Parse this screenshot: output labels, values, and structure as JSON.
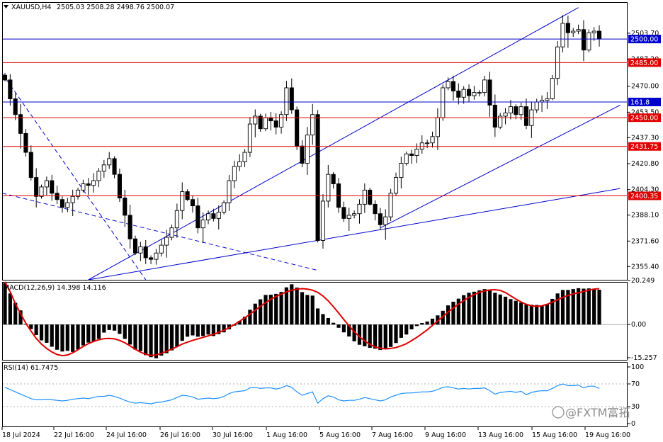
{
  "header": {
    "symbol": "XAUUSD,H4",
    "ohlc": "2505.03 2508.28 2498.76 2500.07"
  },
  "macd": {
    "label": "MACD(12,26,9) 14.398 14.116"
  },
  "rsi": {
    "label": "RSI(14) 61.7475"
  },
  "watermark": {
    "text": "@FXTM富拓"
  },
  "colors": {
    "bull": "#ffffff",
    "bear": "#000000",
    "trendline": "#0000cd",
    "support": "#e00000",
    "macd_signal": "#e00000",
    "rsi_line": "#1e90ff"
  },
  "chart_data": [
    {
      "type": "candlestick",
      "name": "price",
      "ylim": [
        2347,
        2523
      ],
      "y_ticks": [
        "2503.70",
        "2487.20",
        "2470.00",
        "2453.50",
        "2437.30",
        "2420.80",
        "2404.30",
        "2388.10",
        "2371.60",
        "2355.40"
      ],
      "x_ticks": [
        "18 Jul 2024",
        "22 Jul 16:00",
        "24 Jul 16:00",
        "26 Jul 16:00",
        "30 Jul 16:00",
        "1 Aug 16:00",
        "5 Aug 16:00",
        "7 Aug 16:00",
        "9 Aug 16:00",
        "13 Aug 16:00",
        "15 Aug 16:00",
        "19 Aug 16:00"
      ],
      "horizontal_levels": [
        {
          "value": 2500.0,
          "label": "2500.00",
          "color": "blue"
        },
        {
          "value": 2485.0,
          "label": "2485.00",
          "color": "red"
        },
        {
          "value": 2460.0,
          "label": "161.8",
          "color": "blue"
        },
        {
          "value": 2450.0,
          "label": "2450.00",
          "color": "red"
        },
        {
          "value": 2431.75,
          "label": "2431.75",
          "color": "red"
        },
        {
          "value": 2400.35,
          "label": "2400.35",
          "color": "red"
        }
      ],
      "closes": [
        2474,
        2462,
        2452,
        2440,
        2428,
        2412,
        2400,
        2406,
        2410,
        2402,
        2398,
        2393,
        2396,
        2400,
        2404,
        2408,
        2407,
        2410,
        2416,
        2420,
        2424,
        2414,
        2399,
        2388,
        2373,
        2364,
        2368,
        2361,
        2360,
        2364,
        2369,
        2374,
        2380,
        2391,
        2403,
        2398,
        2394,
        2380,
        2385,
        2389,
        2386,
        2390,
        2396,
        2410,
        2419,
        2422,
        2428,
        2446,
        2451,
        2443,
        2450,
        2448,
        2444,
        2452,
        2469,
        2455,
        2432,
        2421,
        2439,
        2452,
        2372,
        2397,
        2414,
        2408,
        2393,
        2386,
        2388,
        2389,
        2395,
        2404,
        2395,
        2389,
        2382,
        2387,
        2402,
        2412,
        2421,
        2427,
        2426,
        2430,
        2434,
        2434,
        2438,
        2450,
        2469,
        2473,
        2467,
        2463,
        2468,
        2464,
        2466,
        2466,
        2474,
        2458,
        2444,
        2451,
        2453,
        2457,
        2452,
        2457,
        2445,
        2455,
        2460,
        2461,
        2462,
        2475,
        2495,
        2510,
        2504,
        2505,
        2506,
        2493,
        2504,
        2505,
        2500
      ],
      "note": "4-hour candles, 115 bars; closes estimated from the price scale"
    },
    {
      "type": "bar",
      "name": "MACD(12,26,9)",
      "ylim": [
        -15.257,
        20.249
      ],
      "y_ticks": [
        "20.249",
        "0.00",
        "-15.257"
      ],
      "values": [
        19.1,
        14.3,
        10.0,
        6.5,
        0.2,
        -2.1,
        -4.8,
        -7.3,
        -8.4,
        -10.2,
        -11.6,
        -12.4,
        -12.1,
        -12.6,
        -11.5,
        -9.6,
        -8.3,
        -7.7,
        -6.6,
        -3.7,
        -2.5,
        -2.8,
        -4.3,
        -6.6,
        -9.2,
        -11.5,
        -12.2,
        -14.1,
        -15.0,
        -15.5,
        -14.3,
        -13.2,
        -11.9,
        -10.2,
        -7.5,
        -5.6,
        -5.0,
        -5.6,
        -5.3,
        -4.6,
        -5.3,
        -4.4,
        -3.6,
        -2.2,
        -0.5,
        1.6,
        3.6,
        6.8,
        9.6,
        11.6,
        13.6,
        13.7,
        14.1,
        15.0,
        17.1,
        18.5,
        17.0,
        14.9,
        13.6,
        13.3,
        7.4,
        4.8,
        3.0,
        0.8,
        -1.5,
        -3.6,
        -5.5,
        -7.7,
        -9.3,
        -10.0,
        -10.7,
        -11.1,
        -11.7,
        -11.3,
        -10.3,
        -8.5,
        -6.1,
        -4.6,
        -2.2,
        -0.7,
        0.7,
        1.4,
        2.7,
        4.2,
        6.3,
        8.8,
        10.5,
        11.9,
        13.5,
        14.6,
        15.1,
        15.7,
        16.3,
        16.1,
        14.6,
        13.8,
        12.8,
        11.7,
        10.9,
        10.1,
        9.3,
        9.1,
        9.0,
        8.8,
        9.5,
        11.8,
        14.3,
        15.9,
        15.9,
        16.3,
        16.7,
        16.5,
        16.6,
        16.5,
        16.0
      ],
      "signal": [
        19.6,
        15.0,
        9.6,
        5.0,
        0.6,
        -3.0,
        -6.4,
        -9.0,
        -11.0,
        -12.6,
        -13.8,
        -14.3,
        -14.0,
        -13.0,
        -11.6,
        -10.1,
        -8.8,
        -7.8,
        -7.0,
        -6.5,
        -6.4,
        -6.6,
        -7.3,
        -8.4,
        -9.8,
        -11.4,
        -12.7,
        -13.7,
        -14.2,
        -14.0,
        -13.3,
        -12.3,
        -11.3,
        -10.2,
        -9.0,
        -8.1,
        -7.3,
        -6.6,
        -5.9,
        -5.2,
        -4.5,
        -3.6,
        -2.7,
        -1.4,
        0.0,
        1.5,
        3.1,
        4.8,
        6.6,
        8.4,
        10.1,
        11.6,
        12.9,
        14.0,
        15.0,
        15.8,
        16.3,
        16.5,
        16.3,
        15.8,
        14.8,
        13.1,
        10.9,
        8.2,
        5.3,
        2.3,
        -0.6,
        -3.3,
        -5.6,
        -7.6,
        -9.1,
        -10.3,
        -10.9,
        -11.2,
        -11.0,
        -10.6,
        -9.8,
        -8.8,
        -7.4,
        -5.9,
        -4.2,
        -2.4,
        -0.4,
        1.6,
        3.7,
        5.7,
        7.6,
        9.4,
        11.0,
        12.5,
        13.8,
        14.8,
        15.5,
        15.9,
        16.0,
        15.7,
        14.7,
        13.2,
        11.7,
        10.4,
        9.3,
        8.6,
        8.4,
        8.6,
        9.3,
        10.3,
        11.4,
        12.5,
        13.4,
        14.1,
        14.6,
        15.2,
        15.8,
        16.3,
        16.5
      ]
    },
    {
      "type": "line",
      "name": "RSI(14)",
      "ylim": [
        0,
        100
      ],
      "levels": [
        70,
        30
      ],
      "y_ticks": [
        "100",
        "70",
        "30",
        "0"
      ],
      "values": [
        64,
        60,
        56,
        52,
        48,
        44,
        42,
        42,
        43,
        42,
        41,
        40,
        41,
        43,
        44,
        45,
        44,
        46,
        48,
        48,
        50,
        48,
        45,
        41,
        38,
        36,
        37,
        36,
        35,
        37,
        38,
        40,
        42,
        46,
        50,
        49,
        47,
        43,
        44,
        45,
        44,
        45,
        48,
        53,
        56,
        57,
        58,
        63,
        64,
        62,
        63,
        63,
        61,
        63,
        67,
        64,
        56,
        50,
        53,
        56,
        36,
        44,
        49,
        47,
        42,
        40,
        41,
        41,
        43,
        46,
        44,
        42,
        40,
        42,
        47,
        50,
        53,
        54,
        54,
        55,
        56,
        56,
        57,
        60,
        64,
        65,
        63,
        61,
        62,
        61,
        62,
        62,
        63,
        58,
        52,
        55,
        56,
        57,
        55,
        57,
        51,
        55,
        57,
        58,
        58,
        62,
        67,
        70,
        67,
        67,
        68,
        63,
        66,
        66,
        62
      ]
    }
  ]
}
